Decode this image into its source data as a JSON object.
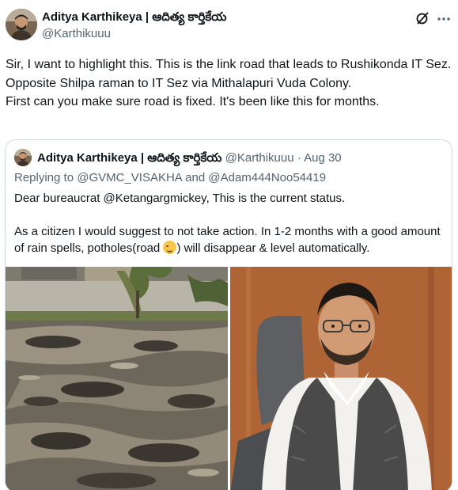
{
  "tweet": {
    "author_name": "Aditya Karthikeya | ఆదిత్య కార్తికేయ",
    "author_handle": "@Karthikuuu",
    "text": "Sir, I want to highlight this. This is the link road that leads to Rushikonda IT Sez.\nOpposite Shilpa raman to IT Sez via Mithalapuri Vuda Colony.\nFirst can you make sure road is fixed. It's been like this for months.",
    "grok_icon": "grok-icon",
    "more_icon": "more-icon"
  },
  "quote": {
    "author_name": "Aditya Karthikeya | ఆదిత్య కార్తికేయ",
    "author_handle": "@Karthikuuu",
    "separator": "·",
    "date": "Aug 30",
    "replying_prefix": "Replying to",
    "replying_to_1": "@GVMC_VISAKHA",
    "replying_and": "and",
    "replying_to_2": "@Adam444Noo54419",
    "text_1": "Dear bureaucrat @Ketangargmickey, This is the current status.\n\nAs a citizen I would suggest to not take action. In 1-2 months with a good amount of rain spells, potholes(road ",
    "text_2": ") will disappear & level automatically.",
    "emoji_icon": "winking-face-icon",
    "photos": [
      "road-potholes-photo",
      "official-portrait-photo"
    ]
  }
}
